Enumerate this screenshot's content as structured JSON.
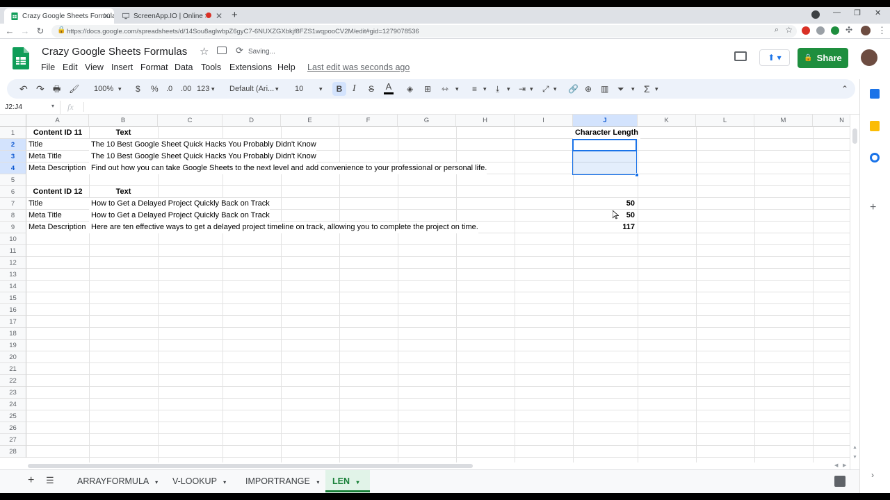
{
  "browser": {
    "tabs": [
      {
        "title": "Crazy Google Sheets Formulas -",
        "active": true
      },
      {
        "title": "ScreenApp.IO | Online Screen",
        "active": false
      }
    ],
    "new_tab": "+",
    "url": "https://docs.google.com/spreadsheets/d/14Sou8aglwbpZ6gyC7-6NUXZGXbkjf8FZS1wqpooCV2M/edit#gid=1279078536"
  },
  "doc": {
    "title": "Crazy Google Sheets Formulas",
    "status": "Saving...",
    "menu": [
      "File",
      "Edit",
      "View",
      "Insert",
      "Format",
      "Data",
      "Tools",
      "Extensions",
      "Help"
    ],
    "last_edit": "Last edit was seconds ago",
    "share_label": "Share"
  },
  "toolbar": {
    "zoom": "100%",
    "currency": "$",
    "percent": "%",
    "dec_decrease": ".0",
    "dec_increase": ".00",
    "format_more": "123",
    "font": "Default (Ari...",
    "font_size": "10",
    "bold": "B",
    "italic": "I",
    "strike": "S",
    "text_color": "A",
    "sum": "Σ"
  },
  "formula_bar": {
    "name_box": "J2:J4",
    "fx": "fx",
    "value": ""
  },
  "grid": {
    "columns": [
      "A",
      "B",
      "C",
      "D",
      "E",
      "F",
      "G",
      "H",
      "I",
      "J",
      "K",
      "L",
      "M",
      "N"
    ],
    "rows": [
      "1",
      "2",
      "3",
      "4",
      "5",
      "6",
      "7",
      "8",
      "9",
      "10",
      "11",
      "12",
      "13",
      "14",
      "15",
      "16",
      "17",
      "18",
      "19",
      "20",
      "21",
      "22",
      "23",
      "24",
      "25",
      "26",
      "27",
      "28"
    ],
    "cells": {
      "A1": "Content ID 11",
      "B1": "Text",
      "J1": "Character Length",
      "A2": "Title",
      "B2": "The 10 Best Google Sheet Quick Hacks You Probably Didn't Know",
      "A3": "Meta Title",
      "B3": "The 10 Best Google Sheet Quick Hacks You Probably Didn't Know",
      "A4": "Meta Description",
      "B4": "Find out how you can take Google Sheets to the next level and add convenience to your professional or personal life.",
      "A6": "Content ID 12",
      "B6": "Text",
      "A7": "Title",
      "B7": "How to Get a Delayed Project Quickly Back on Track",
      "J7": "50",
      "A8": "Meta Title",
      "B8": "How to Get a Delayed Project Quickly Back on Track",
      "J8": "50",
      "A9": "Meta Description",
      "B9": "Here are ten effective ways to get a delayed project timeline on track, allowing you to complete the project on time.",
      "J9": "117"
    }
  },
  "sheet_tabs": [
    {
      "label": "ARRAYFORMULA",
      "active": false
    },
    {
      "label": "V-LOOKUP",
      "active": false
    },
    {
      "label": "IMPORTRANGE",
      "active": false
    },
    {
      "label": "LEN",
      "active": true
    }
  ],
  "colors": {
    "accent_green": "#188038",
    "selection_blue": "#1a73e8",
    "share_green": "#1e8e3e"
  }
}
